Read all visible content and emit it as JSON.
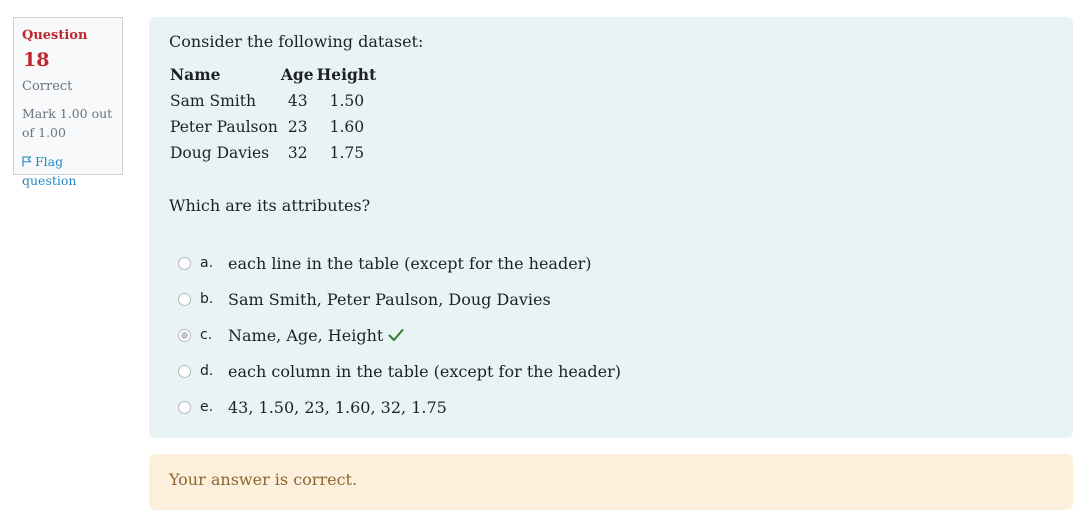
{
  "info": {
    "question_label": "Question",
    "question_number": "18",
    "state": "Correct",
    "grade": "Mark 1.00 out of 1.00",
    "flag_label": "Flag question"
  },
  "question": {
    "intro": "Consider the following dataset:",
    "table": {
      "headers": [
        "Name",
        "Age",
        "Height"
      ],
      "rows": [
        [
          "Sam Smith",
          "43",
          "1.50"
        ],
        [
          "Peter Paulson",
          "23",
          "1.60"
        ],
        [
          "Doug Davies",
          "32",
          "1.75"
        ]
      ]
    },
    "prompt": "Which are its attributes?",
    "answers": [
      {
        "letter": "a.",
        "text": "each line in the table (except for the header)",
        "selected": false,
        "correct": false
      },
      {
        "letter": "b.",
        "text": "Sam Smith, Peter Paulson, Doug Davies",
        "selected": false,
        "correct": false
      },
      {
        "letter": "c.",
        "text": "Name, Age, Height",
        "selected": true,
        "correct": true
      },
      {
        "letter": "d.",
        "text": "each column in the table (except for the header)",
        "selected": false,
        "correct": false
      },
      {
        "letter": "e.",
        "text": "43, 1.50, 23, 1.60, 32, 1.75",
        "selected": false,
        "correct": false
      }
    ]
  },
  "feedback": {
    "text": "Your answer is correct."
  },
  "colors": {
    "question_accent": "#c0262d",
    "formulation_bg": "#e7f3f5",
    "feedback_bg": "#fcefdc",
    "feedback_text": "#8e662e",
    "correct_check": "#357a32",
    "link": "#1f89c2"
  },
  "icons": {
    "flag": "flag-icon",
    "correct": "check-icon"
  }
}
